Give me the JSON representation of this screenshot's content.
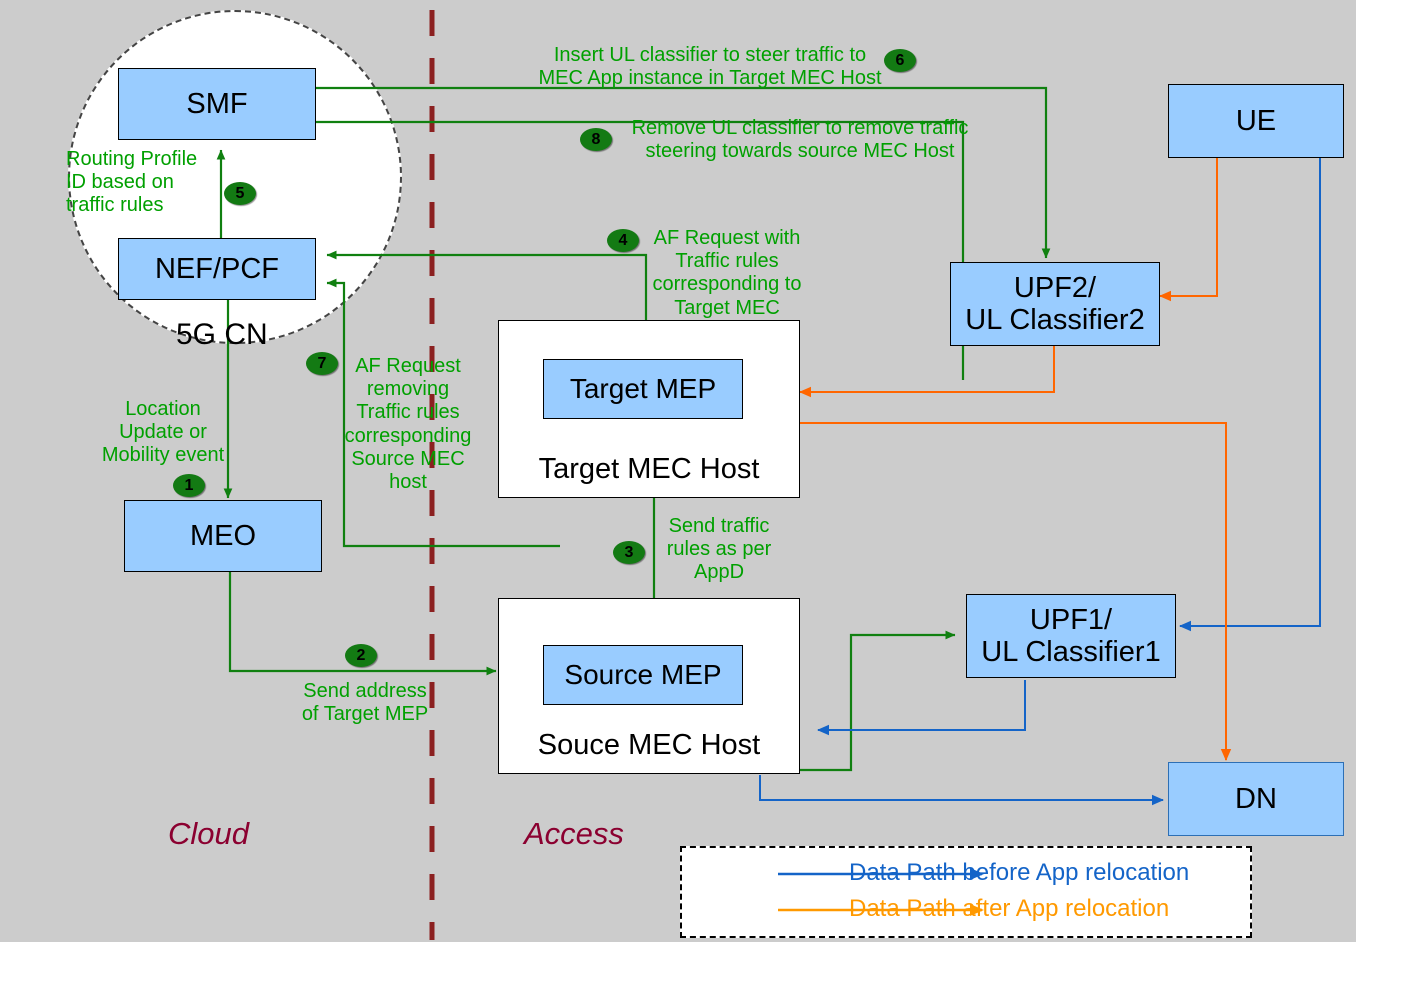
{
  "diagram": {
    "title": "MEC application relocation with 5G core network",
    "background_color": "#cccccc",
    "node_fill": "#99ccff",
    "flow_color": "#00A000",
    "before_path_color": "#1464C8",
    "after_path_color": "#FF9900",
    "region_color": "#8B0030"
  },
  "regions": {
    "cloud": "Cloud",
    "access": "Access",
    "core_network": "5G CN"
  },
  "nodes": {
    "smf": "SMF",
    "nef_pcf": "NEF/PCF",
    "meo": "MEO",
    "ue": "UE",
    "upf2_line1": "UPF2/",
    "upf2_line2": "UL Classifier2",
    "upf1_line1": "UPF1/",
    "upf1_line2": "UL Classifier1",
    "dn": "DN",
    "target_mep": "Target MEP",
    "target_mec_host": "Target MEC Host",
    "source_mep": "Source MEP",
    "source_mec_host": "Souce MEC Host"
  },
  "flows": [
    {
      "id": "1",
      "label": "Location\nUpdate or\nMobility event"
    },
    {
      "id": "2",
      "label": "Send address\nof Target MEP"
    },
    {
      "id": "3",
      "label": "Send traffic\nrules as per\nAppD"
    },
    {
      "id": "4",
      "label": "AF Request with\nTraffic rules\ncorresponding to\nTarget MEC"
    },
    {
      "id": "5",
      "label": "Routing Profile\nID based on\ntraffic rules"
    },
    {
      "id": "6",
      "label": "Insert UL classifier to steer traffic to\nMEC App instance in Target MEC Host"
    },
    {
      "id": "7",
      "label": "AF Request\nremoving\nTraffic rules\ncorresponding\nSource MEC\nhost"
    },
    {
      "id": "8",
      "label": "Remove UL classifier to remove traffic\nsteering towards source MEC Host"
    }
  ],
  "flow_text": {
    "f1_l1": "Location",
    "f1_l2": "Update or",
    "f1_l3": "Mobility event",
    "f2_l1": "Send address",
    "f2_l2": "of Target MEP",
    "f3_l1": "Send traffic",
    "f3_l2": "rules as per",
    "f3_l3": "AppD",
    "f4_l1": "AF Request with",
    "f4_l2": "Traffic rules",
    "f4_l3": "corresponding to",
    "f4_l4": "Target MEC",
    "f5_l1": "Routing Profile",
    "f5_l2": "ID based on",
    "f5_l3": "traffic rules",
    "f6_l1": "Insert UL classifier to steer traffic to",
    "f6_l2": "MEC App instance in Target MEC Host",
    "f7_l1": "AF Request",
    "f7_l2": "removing",
    "f7_l3": "Traffic rules",
    "f7_l4": "corresponding",
    "f7_l5": "Source MEC",
    "f7_l6": "host",
    "f8_l1": "Remove UL classifier to remove traffic",
    "f8_l2": "steering towards source MEC Host"
  },
  "badges": {
    "b1": "1",
    "b2": "2",
    "b3": "3",
    "b4": "4",
    "b5": "5",
    "b6": "6",
    "b7": "7",
    "b8": "8"
  },
  "legend": {
    "before": "Data Path before App relocation",
    "after": "Data Path after App relocation"
  }
}
